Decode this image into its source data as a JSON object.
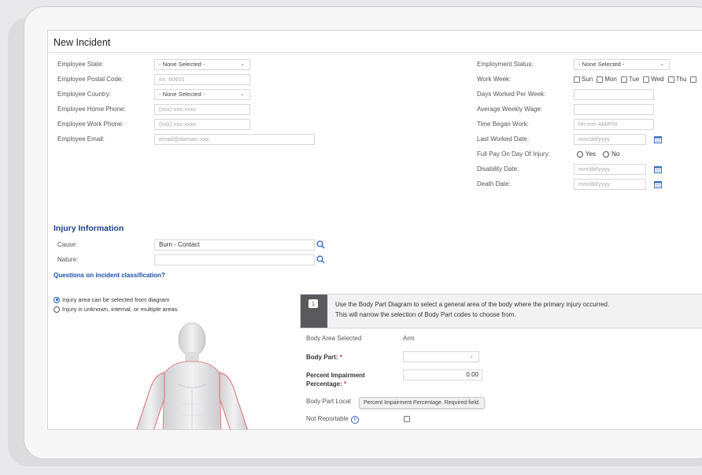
{
  "form": {
    "title": "New Incident",
    "left_fields": [
      {
        "label": "Employee State:",
        "type": "select",
        "value": "- None Selected -",
        "placeholder": ""
      },
      {
        "label": "Employee Postal Code:",
        "type": "input",
        "value": "",
        "placeholder": "ex: 60601"
      },
      {
        "label": "Employee Country:",
        "type": "select",
        "value": "- None Selected -",
        "placeholder": ""
      },
      {
        "label": "Employee Home Phone:",
        "type": "input",
        "value": "",
        "placeholder": "(xxx) xxx-xxxx"
      },
      {
        "label": "Employee Work Phone:",
        "type": "input",
        "value": "",
        "placeholder": "(xxx) xxx-xxxx"
      },
      {
        "label": "Employee Email:",
        "type": "input",
        "value": "",
        "placeholder": "email@domain.xxx"
      }
    ],
    "right_fields": {
      "employment_status": {
        "label": "Employment Status:",
        "value": "- None Selected -"
      },
      "work_week": {
        "label": "Work Week:",
        "days": [
          "Sun",
          "Mon",
          "Tue",
          "Wed",
          "Thu"
        ]
      },
      "days_worked": {
        "label": "Days Worked Per Week:",
        "placeholder": ""
      },
      "avg_weekly_wage": {
        "label": "Average Weekly Wage:",
        "placeholder": ""
      },
      "time_began_work": {
        "label": "Time Began Work:",
        "placeholder": "hh:mm AM/PM"
      },
      "last_worked_date": {
        "label": "Last Worked Date:",
        "placeholder": "mm/dd/yyyy"
      },
      "full_pay": {
        "label": "Full Pay On Day Of Injury:",
        "options": [
          "Yes",
          "No"
        ]
      },
      "disability_date": {
        "label": "Disability Date:",
        "placeholder": "mm/dd/yyyy"
      },
      "death_date": {
        "label": "Death Date:",
        "placeholder": "mm/dd/yyyy"
      }
    }
  },
  "injury": {
    "section_title": "Injury Information",
    "cause": {
      "label": "Cause:",
      "value": "Burn - Contact"
    },
    "nature": {
      "label": "Nature:",
      "value": ""
    },
    "classification_link": "Questions on incident classification?",
    "area_options": [
      {
        "label": "Injury area can be selected from diagram",
        "selected": true
      },
      {
        "label": "Injury is unknown, internal, or multiple areas",
        "selected": false
      }
    ],
    "info_line1": "Use the Body Part Diagram to select a general area of the body where the primary injury occurred.",
    "info_line2": "This will narrow the selection of Body Part codes to choose from.",
    "info_icon_glyph": "i",
    "body_area": {
      "label": "Body Area Selected",
      "value": "Arm"
    },
    "body_part": {
      "label": "Body Part:",
      "required_mark": "*",
      "value": ""
    },
    "percent_impairment": {
      "label_line1": "Percent Impairment",
      "label_line2": "Percentage:",
      "required_mark": "*",
      "value": "0.00"
    },
    "body_part_location": {
      "label": "Body Part Locat"
    },
    "tooltip": "Percent Impairment Percentage. Required field.",
    "not_reportable": {
      "label": "Not Reportable",
      "info_glyph": "i"
    }
  },
  "colors": {
    "accent": "#1a3f8f",
    "link": "#1a4ea8",
    "required": "#dd3333",
    "info_strip": "#5a5a5e",
    "diagram_highlight": "#e06a6a"
  }
}
